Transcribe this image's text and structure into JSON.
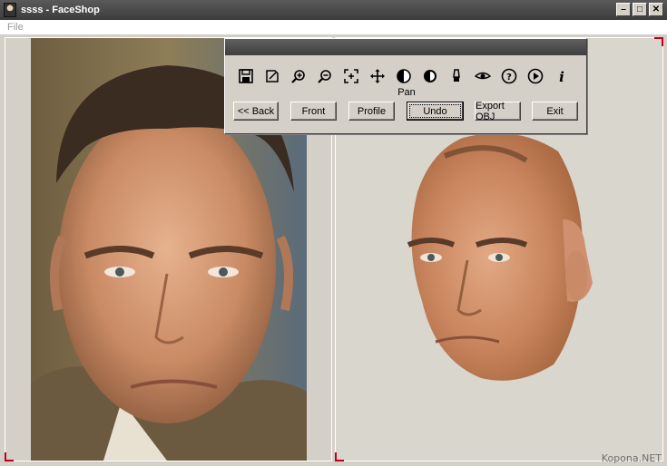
{
  "window": {
    "title": "ssss - FaceShop"
  },
  "menu": {
    "file_label": "File"
  },
  "toolbar": {
    "icons": [
      "save-icon",
      "edit-icon",
      "zoom-in-icon",
      "zoom-out-icon",
      "fit-icon",
      "pan-icon",
      "contrast-icon",
      "brightness-icon",
      "brush-icon",
      "eye-icon",
      "help-icon",
      "play-icon",
      "info-icon"
    ],
    "active_tool_label": "Pan",
    "buttons": {
      "back": "<< Back",
      "front": "Front",
      "profile": "Profile",
      "undo": "Undo",
      "export": "Export OBJ",
      "exit": "Exit"
    }
  },
  "watermark": "Kopona.NET",
  "colors": {
    "corner_marker": "#c0001a",
    "title_bar": "#4a4a4a"
  }
}
